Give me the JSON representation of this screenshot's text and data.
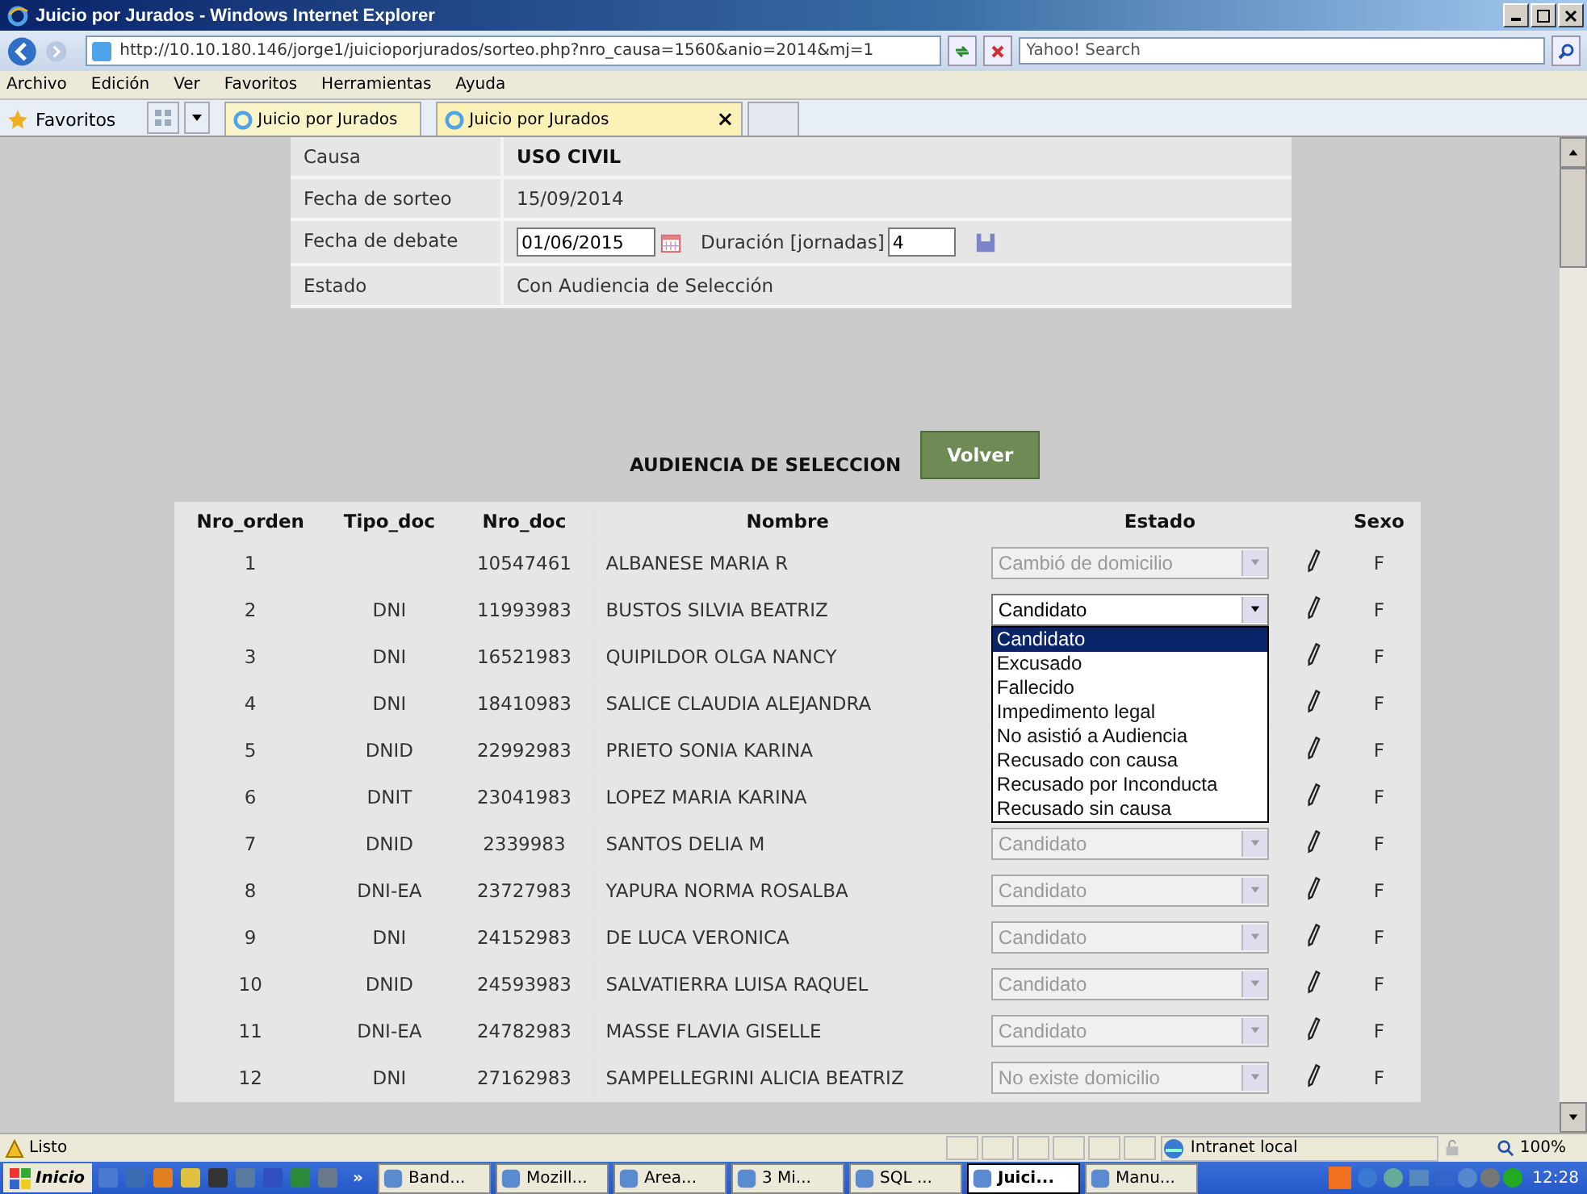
{
  "window": {
    "title": "Juicio por Jurados - Windows Internet Explorer"
  },
  "address": {
    "url": "http://10.10.180.146/jorge1/juicioporjurados/sorteo.php?nro_causa=1560&anio=2014&mj=1"
  },
  "search": {
    "placeholder": "Yahoo! Search"
  },
  "menu": [
    "Archivo",
    "Edición",
    "Ver",
    "Favoritos",
    "Herramientas",
    "Ayuda"
  ],
  "favorites": {
    "label": "Favoritos"
  },
  "tabs": [
    {
      "label": "Juicio por Jurados",
      "selected": false
    },
    {
      "label": "Juicio por Jurados",
      "selected": true,
      "close": "×"
    }
  ],
  "info": [
    {
      "label": "Causa",
      "value": "USO CIVIL",
      "kind": "text"
    },
    {
      "label": "Fecha de sorteo",
      "value": "15/09/2014",
      "kind": "text"
    },
    {
      "label": "Fecha de debate",
      "date": "01/06/2015",
      "duration_label": "Duración [jornadas]",
      "duration": "4",
      "kind": "debate"
    },
    {
      "label": "Estado",
      "value": "Con Audiencia de Selección",
      "kind": "text"
    }
  ],
  "section_title": "AUDIENCIA DE SELECCION",
  "back_button": "Volver",
  "table": {
    "columns": [
      "Nro_orden",
      "Tipo_doc",
      "Nro_doc",
      "Nombre",
      "Estado",
      "Sexo"
    ],
    "rows": [
      {
        "orden": "1",
        "tipo": "",
        "doc": "10547461",
        "nombre": "ALBANESE MARIA R",
        "estado": "Cambió de domicilio",
        "disabled": true,
        "sexo": "F"
      },
      {
        "orden": "2",
        "tipo": "DNI",
        "doc": "11993983",
        "nombre": "BUSTOS SILVIA BEATRIZ",
        "estado": "Candidato",
        "disabled": false,
        "expanded": true,
        "sexo": "F"
      },
      {
        "orden": "3",
        "tipo": "DNI",
        "doc": "16521983",
        "nombre": "QUIPILDOR OLGA NANCY",
        "sexo": "F"
      },
      {
        "orden": "4",
        "tipo": "DNI",
        "doc": "18410983",
        "nombre": "SALICE CLAUDIA ALEJANDRA",
        "sexo": "F"
      },
      {
        "orden": "5",
        "tipo": "DNID",
        "doc": "22992983",
        "nombre": "PRIETO SONIA KARINA",
        "sexo": "F"
      },
      {
        "orden": "6",
        "tipo": "DNIT",
        "doc": "23041983",
        "nombre": "LOPEZ MARIA KARINA",
        "sexo": "F"
      },
      {
        "orden": "7",
        "tipo": "DNID",
        "doc": "2339983",
        "nombre": "SANTOS DELIA M",
        "estado": "Candidato",
        "disabled": true,
        "sexo": "F"
      },
      {
        "orden": "8",
        "tipo": "DNI-EA",
        "doc": "23727983",
        "nombre": "YAPURA NORMA ROSALBA",
        "estado": "Candidato",
        "disabled": true,
        "sexo": "F"
      },
      {
        "orden": "9",
        "tipo": "DNI",
        "doc": "24152983",
        "nombre": "DE LUCA VERONICA",
        "estado": "Candidato",
        "disabled": true,
        "sexo": "F"
      },
      {
        "orden": "10",
        "tipo": "DNID",
        "doc": "24593983",
        "nombre": "SALVATIERRA LUISA RAQUEL",
        "estado": "Candidato",
        "disabled": true,
        "sexo": "F"
      },
      {
        "orden": "11",
        "tipo": "DNI-EA",
        "doc": "24782983",
        "nombre": "MASSE FLAVIA GISELLE",
        "estado": "Candidato",
        "disabled": true,
        "sexo": "F"
      },
      {
        "orden": "12",
        "tipo": "DNI",
        "doc": "27162983",
        "nombre": "SAMPELLEGRINI ALICIA BEATRIZ",
        "estado": "No existe domicilio",
        "disabled": true,
        "sexo": "F"
      }
    ]
  },
  "dropdown": [
    {
      "label": "Candidato",
      "selected": true
    },
    {
      "label": "Excusado",
      "selected": false
    },
    {
      "label": "Fallecido",
      "selected": false
    },
    {
      "label": "Impedimento legal",
      "selected": false
    },
    {
      "label": "No asistió a Audiencia",
      "selected": false
    },
    {
      "label": "Recusado con causa",
      "selected": false
    },
    {
      "label": "Recusado por Inconducta",
      "selected": false
    },
    {
      "label": "Recusado sin causa",
      "selected": false
    }
  ],
  "status_bar": {
    "text": "Listo",
    "zone": "Intranet local",
    "zoom": "100%"
  },
  "taskbar": {
    "start": "Inicio",
    "more": "»",
    "items": [
      {
        "label": "Band...",
        "selected": false
      },
      {
        "label": "Mozill...",
        "selected": false
      },
      {
        "label": "Area...",
        "selected": false
      },
      {
        "label": "3 Mi...",
        "selected": false
      },
      {
        "label": "SQL ...",
        "selected": false
      },
      {
        "label": "Juici...",
        "selected": true
      },
      {
        "label": "Manu...",
        "selected": false
      }
    ],
    "clock": "12:28"
  }
}
